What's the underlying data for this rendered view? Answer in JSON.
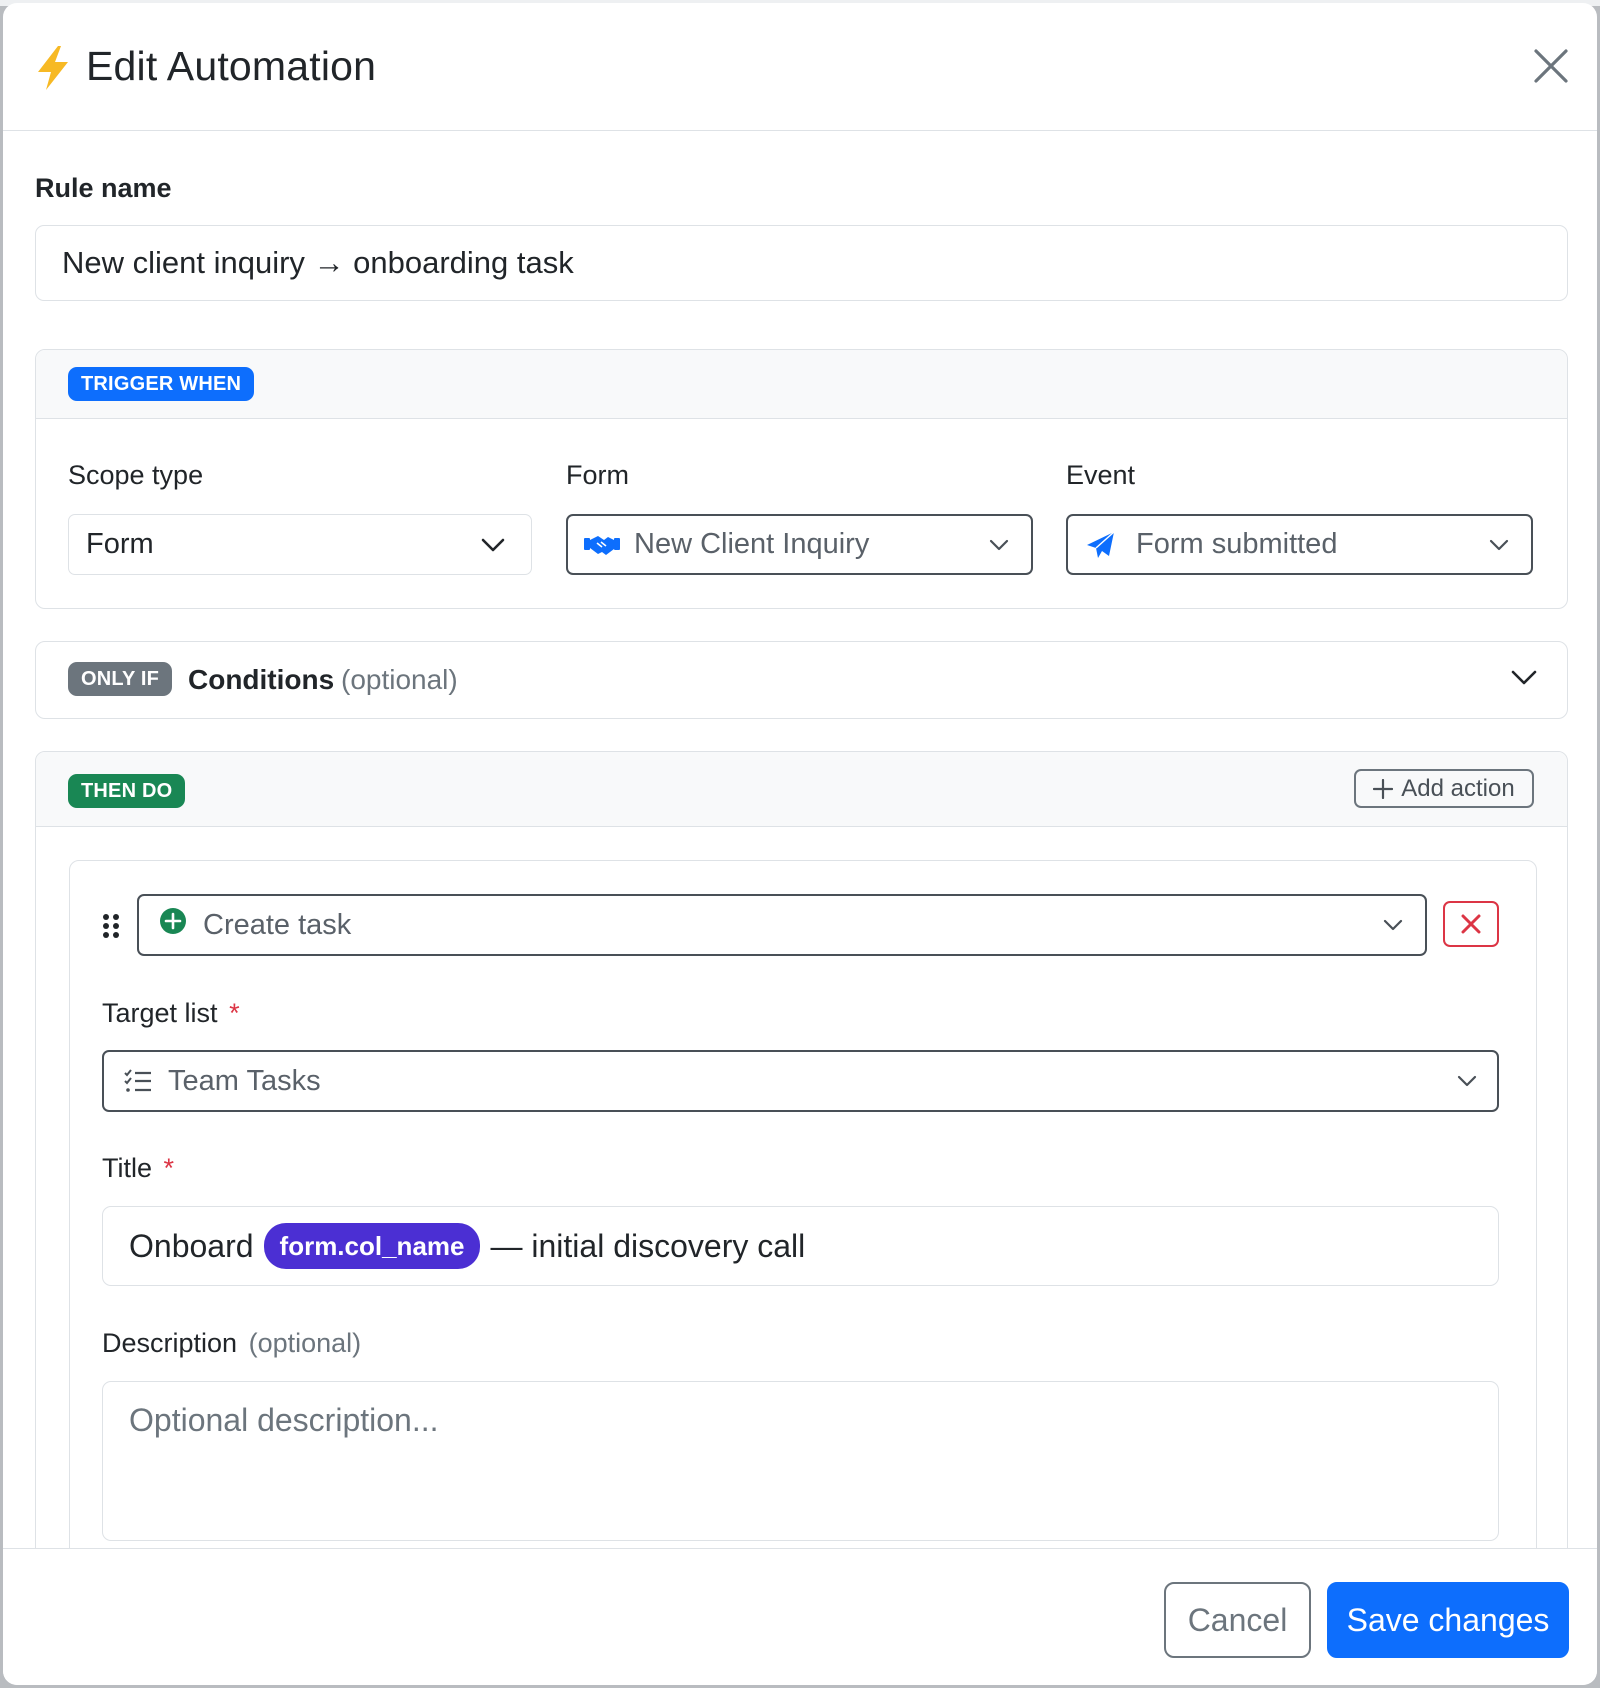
{
  "colors": {
    "primary": "#0d6efd",
    "success": "#198754",
    "secondary": "#6c757d",
    "danger": "#dc3545",
    "warning": "#f7b924",
    "variable_chip": "#4b2fd3"
  },
  "modal": {
    "title": "Edit Automation",
    "title_icon": "lightning-bolt-icon",
    "close_icon": "close-icon"
  },
  "rule": {
    "label": "Rule name",
    "value": "New client inquiry → onboarding task"
  },
  "trigger": {
    "badge": "TRIGGER WHEN",
    "scope_type": {
      "label": "Scope type",
      "value": "Form"
    },
    "form": {
      "label": "Form",
      "value": "New Client Inquiry",
      "icon": "handshake-icon"
    },
    "event": {
      "label": "Event",
      "value": "Form submitted",
      "icon": "paper-plane-icon"
    }
  },
  "conditions": {
    "badge": "ONLY IF",
    "title": "Conditions",
    "optional": "(optional)"
  },
  "actions": {
    "badge": "THEN DO",
    "add_label": "Add action",
    "action": {
      "type": "Create task",
      "type_icon": "plus-circle-icon",
      "target_list": {
        "label": "Target list",
        "required": "*",
        "value": "Team Tasks",
        "icon": "checklist-icon"
      },
      "title": {
        "label": "Title",
        "required": "*",
        "prefix": "Onboard",
        "variable": "form.col_name",
        "suffix": "— initial discovery call"
      },
      "description": {
        "label": "Description",
        "optional": "(optional)",
        "placeholder": "Optional description..."
      }
    }
  },
  "footer": {
    "cancel": "Cancel",
    "save": "Save changes"
  }
}
